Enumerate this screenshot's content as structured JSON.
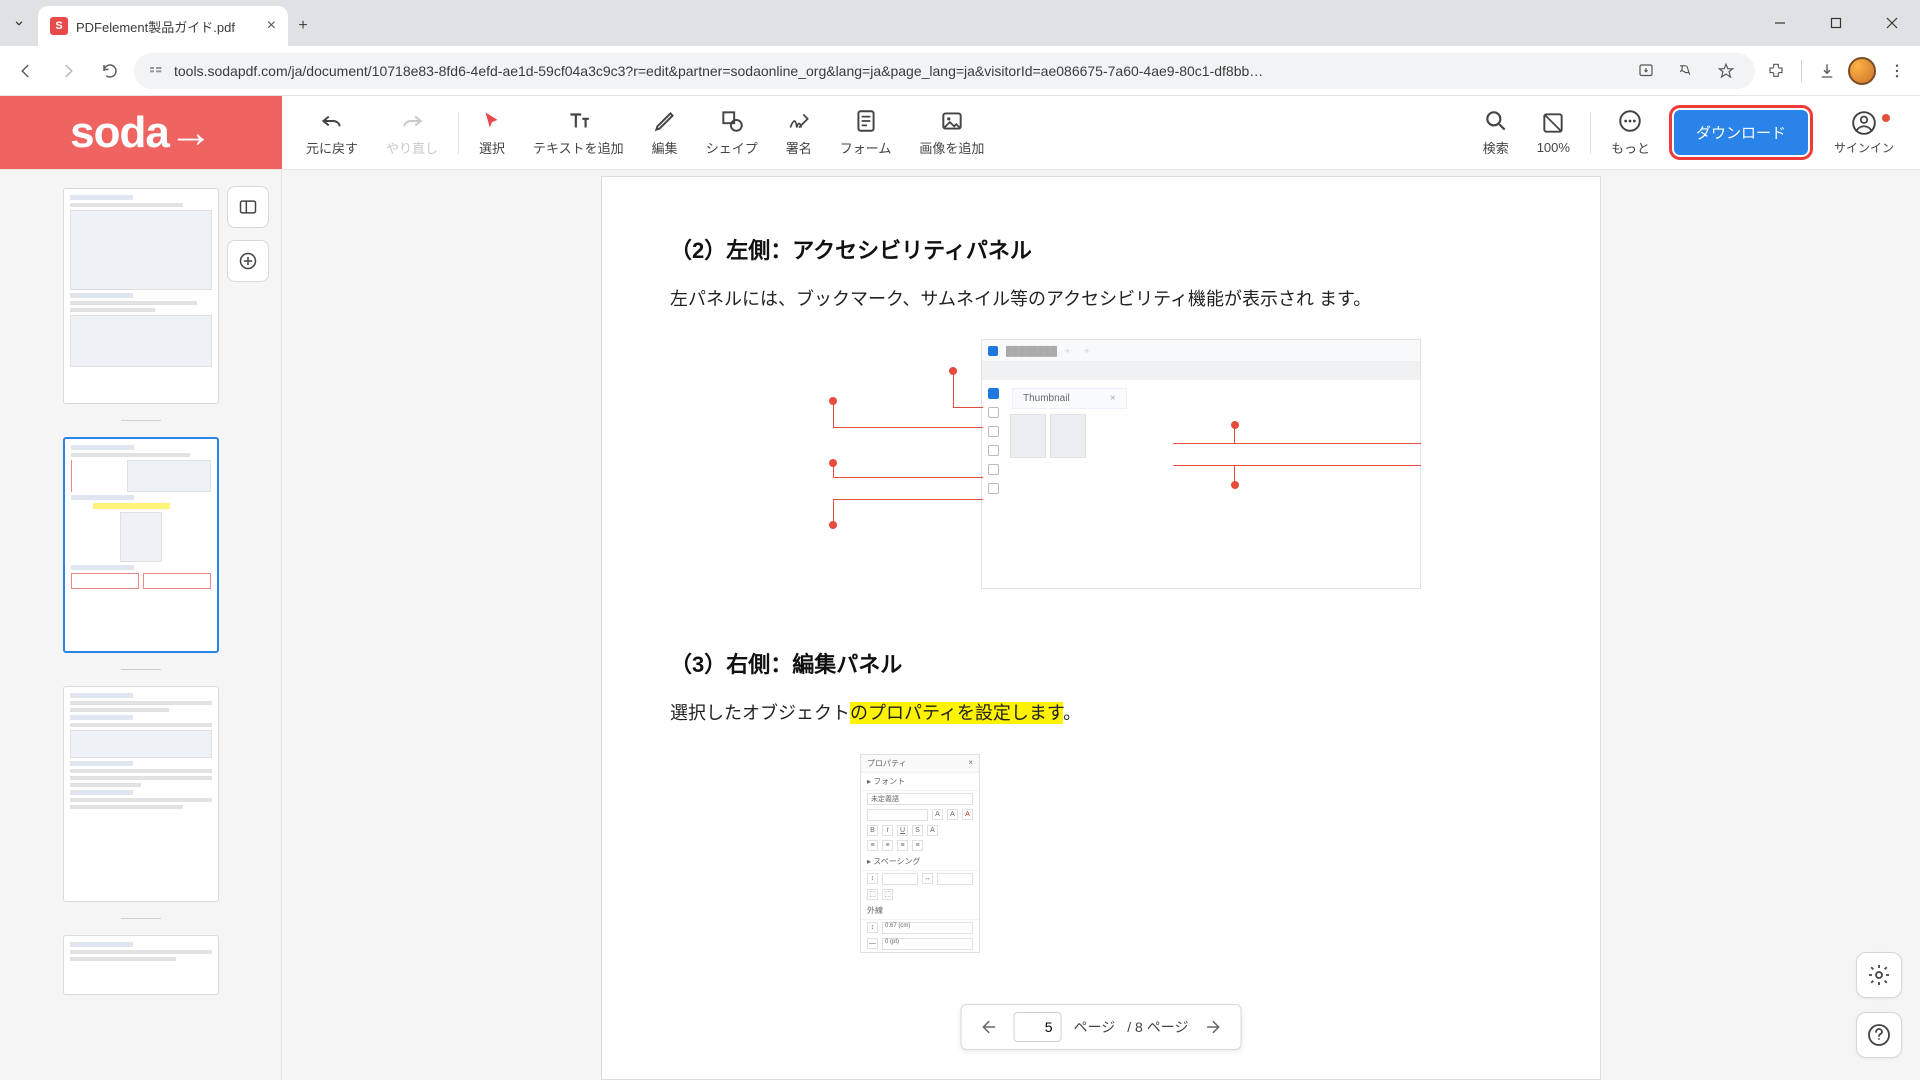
{
  "browser": {
    "tab_title": "PDFelement製品ガイド.pdf",
    "url": "tools.sodapdf.com/ja/document/10718e83-8fd6-4efd-ae1d-59cf04a3c9c3?r=edit&partner=sodaonline_org&lang=ja&page_lang=ja&visitorId=ae086675-7a60-4ae9-80c1-df8bb…",
    "favicon_letter": "S"
  },
  "soda": {
    "logo": "soda→",
    "tools": {
      "undo": "元に戻す",
      "redo": "やり直し",
      "select": "選択",
      "text": "テキストを追加",
      "edit": "編集",
      "shape": "シェイプ",
      "sign": "署名",
      "form": "フォーム",
      "image": "画像を追加",
      "search": "検索",
      "zoom": "100%",
      "more": "もっと"
    },
    "download": "ダウンロード",
    "signin": "サインイン"
  },
  "document": {
    "section2_title": "（2）左側：アクセシビリティパネル",
    "section2_body": "左パネルには、ブックマーク、サムネイル等のアクセシビリティ機能が表示され ます。",
    "section3_title": "（3）右側：編集パネル",
    "section3_body_pre": "選択したオブジェクト",
    "section3_body_hi": "のプロパティを設定します",
    "section3_body_post": "。",
    "fig1_thumbnail": "Thumbnail",
    "fig2": {
      "header": "プロパティ",
      "font": "フォント",
      "fontvalue": "未定義語",
      "spacing": "スペーシング",
      "outline": "外線",
      "val1": "0.67 (cm)",
      "val2": "0 (pt)"
    }
  },
  "page_nav": {
    "current": "5",
    "label": "ページ",
    "total_label": "/ 8 ページ"
  }
}
